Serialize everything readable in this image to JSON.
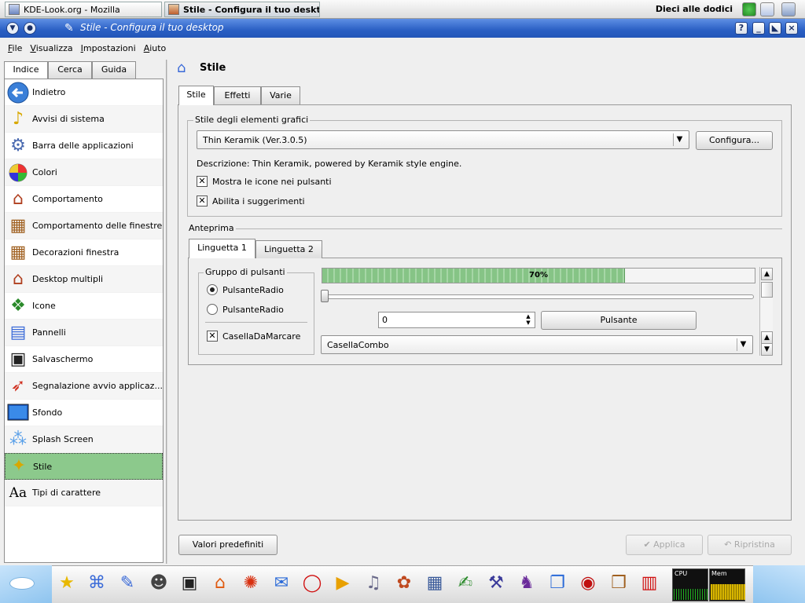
{
  "taskbar": {
    "tasks": [
      {
        "label": "KDE-Look.org - Mozilla"
      },
      {
        "label": "Stile - Configura il tuo desktop"
      }
    ],
    "clock": "Dieci alle dodici"
  },
  "window": {
    "title": "Stile - Configura il tuo desktop",
    "buttons": {
      "help": "?",
      "minimize": "_",
      "maximize": "◣",
      "close": "×"
    }
  },
  "menubar": [
    "File",
    "Visualizza",
    "Impostazioni",
    "Aiuto"
  ],
  "sidebar": {
    "tabs": [
      "Indice",
      "Cerca",
      "Guida"
    ],
    "items": [
      {
        "label": "Indietro",
        "icon": "back-arrow-icon"
      },
      {
        "label": "Avvisi di sistema",
        "icon": "music-note-icon"
      },
      {
        "label": "Barra delle applicazioni",
        "icon": "kde-gear-icon"
      },
      {
        "label": "Colori",
        "icon": "color-wheel-icon"
      },
      {
        "label": "Comportamento",
        "icon": "house-window-icon"
      },
      {
        "label": "Comportamento delle finestre",
        "icon": "window-frame-icon"
      },
      {
        "label": "Decorazioni finestra",
        "icon": "window-frame-icon"
      },
      {
        "label": "Desktop multipli",
        "icon": "house-window-icon"
      },
      {
        "label": "Icone",
        "icon": "icons-icon"
      },
      {
        "label": "Pannelli",
        "icon": "panels-icon"
      },
      {
        "label": "Salvaschermo",
        "icon": "screensaver-icon"
      },
      {
        "label": "Segnalazione avvio applicaz...",
        "icon": "rocket-icon"
      },
      {
        "label": "Sfondo",
        "icon": "wallpaper-icon"
      },
      {
        "label": "Splash Screen",
        "icon": "bubbles-icon"
      },
      {
        "label": "Stile",
        "icon": "style-icon"
      },
      {
        "label": "Tipi di carattere",
        "icon": "fonts-icon"
      }
    ],
    "selected": "Stile"
  },
  "main": {
    "title": "Stile",
    "tabs": [
      "Stile",
      "Effetti",
      "Varie"
    ],
    "widget_style": {
      "group_label": "Stile degli elementi grafici",
      "selected_style": "Thin Keramik (Ver.3.0.5)",
      "configure_label": "Configura...",
      "description": "Descrizione: Thin Keramik, powered by Keramik style engine.",
      "show_icons_label": "Mostra le icone nei pulsanti",
      "show_icons_checked": true,
      "tooltips_label": "Abilita i suggerimenti",
      "tooltips_checked": true
    },
    "preview": {
      "label": "Anteprima",
      "tabs": [
        "Linguetta 1",
        "Linguetta 2"
      ],
      "button_group_label": "Gruppo di pulsanti",
      "radio1": "PulsanteRadio",
      "radio2": "PulsanteRadio",
      "checkbox": "CasellaDaMarcare",
      "checkbox_checked": true,
      "progress_text": "70%",
      "progress_value": 0.7,
      "slider_value": 0,
      "spin_value": "0",
      "button_label": "Pulsante",
      "combo_value": "CasellaCombo"
    },
    "bottom": {
      "defaults": "Valori predefiniti",
      "apply": "Applica",
      "reset": "Ripristina"
    }
  },
  "kicker": {
    "monitors": [
      "CPU",
      "Mem"
    ]
  }
}
